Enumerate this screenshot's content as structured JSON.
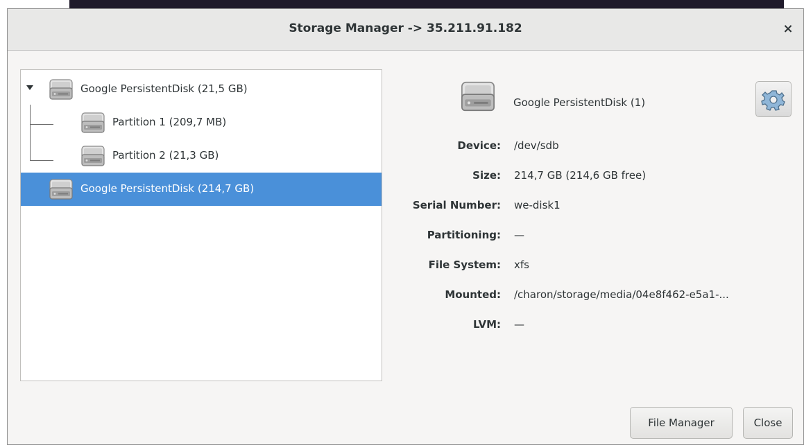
{
  "window": {
    "title": "Storage Manager -> 35.211.91.182",
    "close_glyph": "×"
  },
  "tree": {
    "items": [
      {
        "label": "Google PersistentDisk (21,5 GB)",
        "icon": "hard-disk-icon",
        "expanded": true,
        "selected": false
      },
      {
        "label": "Partition 1 (209,7 MB)",
        "icon": "hard-disk-icon",
        "selected": false
      },
      {
        "label": "Partition 2 (21,3 GB)",
        "icon": "hard-disk-icon",
        "selected": false
      },
      {
        "label": "Google PersistentDisk (214,7 GB)",
        "icon": "hard-disk-icon",
        "selected": true
      }
    ]
  },
  "details": {
    "title": "Google PersistentDisk (1)",
    "icon": "hard-disk-icon",
    "settings_icon": "gear-icon",
    "props": [
      {
        "key": "Device:",
        "value": "/dev/sdb"
      },
      {
        "key": "Size:",
        "value": "214,7 GB (214,6 GB free)"
      },
      {
        "key": "Serial Number:",
        "value": "we-disk1"
      },
      {
        "key": "Partitioning:",
        "value": "—"
      },
      {
        "key": "File System:",
        "value": "xfs"
      },
      {
        "key": "Mounted:",
        "value": "/charon/storage/media/04e8f462-e5a1-..."
      },
      {
        "key": "LVM:",
        "value": "—"
      }
    ]
  },
  "buttons": {
    "file_manager": "File Manager",
    "close": "Close"
  },
  "colors": {
    "selection": "#4a90d9",
    "window_bg": "#f6f5f4"
  }
}
